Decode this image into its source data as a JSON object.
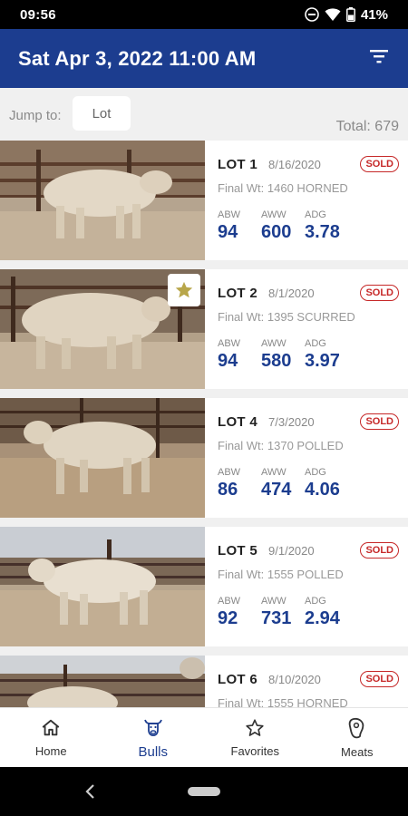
{
  "status": {
    "time": "09:56",
    "battery": "41%"
  },
  "header": {
    "title": "Sat Apr 3, 2022 11:00 AM"
  },
  "jump": {
    "label": "Jump to:",
    "placeholder": "Lot"
  },
  "total": "Total: 679",
  "stat_labels": {
    "abw": "ABW",
    "aww": "AWW",
    "adg": "ADG"
  },
  "lots": [
    {
      "lot": "LOT 1",
      "date": "8/16/2020",
      "badge": "SOLD",
      "final": "Final Wt: 1460  HORNED",
      "abw": "94",
      "aww": "600",
      "adg": "3.78",
      "favorite": false
    },
    {
      "lot": "LOT 2",
      "date": "8/1/2020",
      "badge": "SOLD",
      "final": "Final Wt: 1395  SCURRED",
      "abw": "94",
      "aww": "580",
      "adg": "3.97",
      "favorite": true
    },
    {
      "lot": "LOT 4",
      "date": "7/3/2020",
      "badge": "SOLD",
      "final": "Final Wt: 1370  POLLED",
      "abw": "86",
      "aww": "474",
      "adg": "4.06",
      "favorite": false
    },
    {
      "lot": "LOT 5",
      "date": "9/1/2020",
      "badge": "SOLD",
      "final": "Final Wt: 1555  POLLED",
      "abw": "92",
      "aww": "731",
      "adg": "2.94",
      "favorite": false
    },
    {
      "lot": "LOT 6",
      "date": "8/10/2020",
      "badge": "SOLD",
      "final": "Final Wt: 1555  HORNED",
      "abw": "",
      "aww": "",
      "adg": "",
      "favorite": false
    }
  ],
  "nav": [
    {
      "label": "Home",
      "icon": "home-icon",
      "active": false
    },
    {
      "label": "Bulls",
      "icon": "bull-icon",
      "active": true
    },
    {
      "label": "Favorites",
      "icon": "star-icon",
      "active": false
    },
    {
      "label": "Meats",
      "icon": "meat-icon",
      "active": false
    }
  ],
  "colors": {
    "brand": "#1c3d8f",
    "sold": "#c62828",
    "star": "#b8a64a"
  }
}
